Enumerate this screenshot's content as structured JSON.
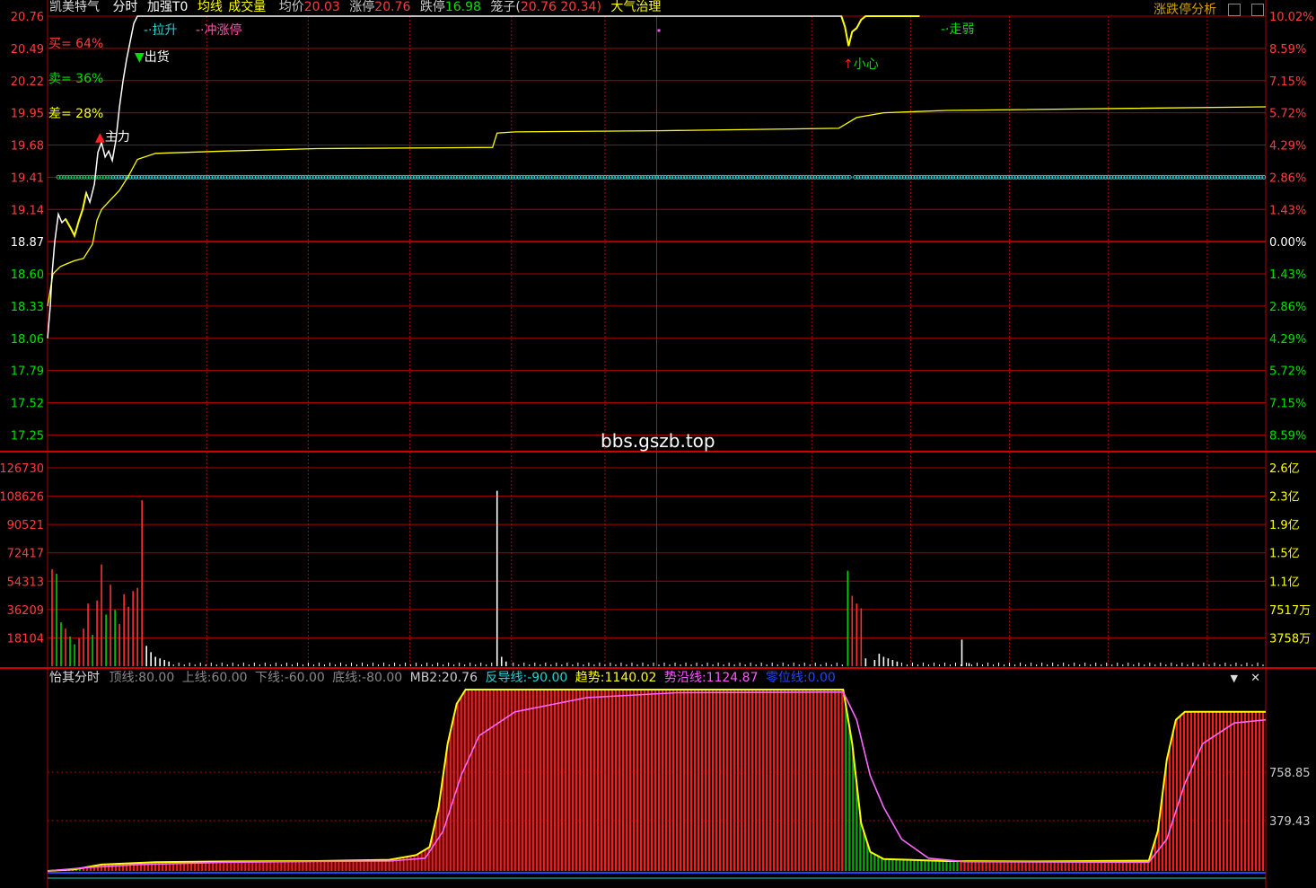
{
  "header": {
    "stock_name": "凯美特气",
    "mode": "分时",
    "strengthen": "加强T0",
    "avg_line_label": "均线",
    "volume_label": "成交量",
    "avg_price_label": "均价",
    "avg_price_value": "20.03",
    "limit_up_label": "涨停",
    "limit_up_value": "20.76",
    "limit_down_label": "跌停",
    "limit_down_value": "16.98",
    "cage_label": "笼子(",
    "cage_value": "20.76 20.34)",
    "atmos": "大气治理",
    "right_link": "涨跌停分析"
  },
  "side_labels": {
    "buy": "买= 64%",
    "sell": "卖= 36%",
    "diff": "差= 28%"
  },
  "signals": {
    "lashen": "拉升",
    "chongzhangting": "冲涨停",
    "zoruo": "走弱",
    "chuhuo": "出货",
    "zhuli": "主力",
    "xiaoxin": "小心"
  },
  "watermark": "bbs.gszb.top",
  "indicator_header": {
    "name": "怡其分时",
    "top_label": "顶线:",
    "top_value": "80.00",
    "upper_label": "上线:",
    "upper_value": "60.00",
    "lower_label": "下线:",
    "lower_value": "-60.00",
    "bottom_label": "底线:",
    "bottom_value": "-80.00",
    "mb2_label": "MB2:",
    "mb2_value": "20.76",
    "reverse_label": "反导线:",
    "reverse_value": "-90.00",
    "trend_label": "趋势:",
    "trend_value": "1140.02",
    "along_label": "势沿线:",
    "along_value": "1124.87",
    "zero_label": "零位线:",
    "zero_value": "0.00"
  },
  "colors": {
    "grid_red": "#b00000",
    "price_white": "#ffffff",
    "avg_yellow": "#ffff00",
    "label_red": "#ff3b3b",
    "label_green": "#00e000",
    "cyan": "#1fd4d4",
    "magenta": "#ff55ff"
  },
  "chart_data": [
    {
      "type": "line",
      "panel": "price",
      "y_ticks_left": [
        "20.76",
        "20.49",
        "20.22",
        "19.95",
        "19.68",
        "19.41",
        "19.14",
        "18.87",
        "18.60",
        "18.33",
        "18.06",
        "17.79",
        "17.52",
        "17.25"
      ],
      "y_ticks_right": [
        "10.02%",
        "8.59%",
        "7.15%",
        "5.72%",
        "4.29%",
        "2.86%",
        "1.43%",
        "0.00%",
        "1.43%",
        "2.86%",
        "4.29%",
        "5.72%",
        "7.15%",
        "8.59%"
      ],
      "ylim": [
        17.11,
        20.76
      ],
      "series": [
        {
          "key": "price",
          "points": [
            [
              0,
              18.06
            ],
            [
              3,
              18.33
            ],
            [
              5,
              18.6
            ],
            [
              8,
              18.87
            ],
            [
              12,
              19.1
            ],
            [
              16,
              19.03
            ],
            [
              20,
              19.06
            ],
            [
              26,
              18.98
            ],
            [
              30,
              18.92
            ],
            [
              35,
              19.05
            ],
            [
              39,
              19.14
            ],
            [
              43,
              19.28
            ],
            [
              47,
              19.2
            ],
            [
              52,
              19.35
            ],
            [
              56,
              19.62
            ],
            [
              60,
              19.7
            ],
            [
              64,
              19.58
            ],
            [
              68,
              19.63
            ],
            [
              72,
              19.55
            ],
            [
              76,
              19.72
            ],
            [
              80,
              20.0
            ],
            [
              84,
              20.22
            ],
            [
              88,
              20.4
            ],
            [
              92,
              20.55
            ],
            [
              96,
              20.7
            ],
            [
              100,
              20.76
            ],
            [
              883,
              20.76
            ],
            [
              887,
              20.67
            ],
            [
              891,
              20.51
            ],
            [
              895,
              20.63
            ],
            [
              900,
              20.66
            ],
            [
              905,
              20.73
            ],
            [
              910,
              20.76
            ],
            [
              970,
              20.76
            ]
          ]
        },
        {
          "key": "average",
          "points": [
            [
              0,
              18.33
            ],
            [
              6,
              18.6
            ],
            [
              14,
              18.66
            ],
            [
              20,
              18.68
            ],
            [
              30,
              18.71
            ],
            [
              40,
              18.73
            ],
            [
              50,
              18.85
            ],
            [
              55,
              19.05
            ],
            [
              60,
              19.14
            ],
            [
              70,
              19.22
            ],
            [
              80,
              19.3
            ],
            [
              90,
              19.42
            ],
            [
              100,
              19.56
            ],
            [
              120,
              19.61
            ],
            [
              200,
              19.63
            ],
            [
              300,
              19.65
            ],
            [
              495,
              19.66
            ],
            [
              500,
              19.78
            ],
            [
              520,
              19.79
            ],
            [
              680,
              19.8
            ],
            [
              880,
              19.82
            ],
            [
              900,
              19.91
            ],
            [
              930,
              19.95
            ],
            [
              1000,
              19.97
            ],
            [
              1355,
              20.0
            ]
          ]
        }
      ],
      "cage_line": {
        "value": 19.41,
        "x_range": [
          12,
          1355
        ],
        "gap": [
          893,
          898
        ]
      },
      "magenta_marker": {
        "x": 680,
        "y": 20.64
      }
    },
    {
      "type": "bar",
      "panel": "volume",
      "y_ticks_left": [
        "126730",
        "108626",
        "90521",
        "72417",
        "54313",
        "36209",
        "18104"
      ],
      "y_ticks_right": [
        "2.6亿",
        "2.3亿",
        "1.9亿",
        "1.5亿",
        "1.1亿",
        "7517万",
        "3758万"
      ],
      "ylim": [
        0,
        126730
      ],
      "bars": [
        {
          "x": 5,
          "v": 62000,
          "c": "r"
        },
        {
          "x": 10,
          "v": 59000,
          "c": "g"
        },
        {
          "x": 15,
          "v": 28000,
          "c": "g"
        },
        {
          "x": 20,
          "v": 24000,
          "c": "r"
        },
        {
          "x": 25,
          "v": 19000,
          "c": "g"
        },
        {
          "x": 30,
          "v": 14000,
          "c": "g"
        },
        {
          "x": 35,
          "v": 18000,
          "c": "r"
        },
        {
          "x": 40,
          "v": 24000,
          "c": "r"
        },
        {
          "x": 45,
          "v": 40000,
          "c": "r"
        },
        {
          "x": 50,
          "v": 20000,
          "c": "g"
        },
        {
          "x": 55,
          "v": 42000,
          "c": "r"
        },
        {
          "x": 60,
          "v": 65000,
          "c": "r"
        },
        {
          "x": 65,
          "v": 33000,
          "c": "g"
        },
        {
          "x": 70,
          "v": 52000,
          "c": "r"
        },
        {
          "x": 75,
          "v": 36000,
          "c": "g"
        },
        {
          "x": 80,
          "v": 27000,
          "c": "r"
        },
        {
          "x": 85,
          "v": 46000,
          "c": "r"
        },
        {
          "x": 90,
          "v": 38000,
          "c": "r"
        },
        {
          "x": 95,
          "v": 48000,
          "c": "r"
        },
        {
          "x": 100,
          "v": 50000,
          "c": "r"
        },
        {
          "x": 105,
          "v": 106000,
          "c": "r"
        },
        {
          "x": 110,
          "v": 13000,
          "c": "w"
        },
        {
          "x": 115,
          "v": 9000,
          "c": "w"
        },
        {
          "x": 120,
          "v": 6000,
          "c": "w"
        },
        {
          "x": 125,
          "v": 5000,
          "c": "w"
        },
        {
          "x": 130,
          "v": 4000,
          "c": "w"
        },
        {
          "x": 135,
          "v": 3000,
          "c": "w"
        },
        {
          "x": 500,
          "v": 112000,
          "c": "w"
        },
        {
          "x": 505,
          "v": 6000,
          "c": "w"
        },
        {
          "x": 510,
          "v": 3000,
          "c": "w"
        },
        {
          "x": 890,
          "v": 61000,
          "c": "g"
        },
        {
          "x": 895,
          "v": 45000,
          "c": "r"
        },
        {
          "x": 900,
          "v": 40000,
          "c": "r"
        },
        {
          "x": 905,
          "v": 37000,
          "c": "r"
        },
        {
          "x": 910,
          "v": 5000,
          "c": "w"
        },
        {
          "x": 920,
          "v": 4000,
          "c": "w"
        },
        {
          "x": 925,
          "v": 8000,
          "c": "w"
        },
        {
          "x": 930,
          "v": 6000,
          "c": "w"
        },
        {
          "x": 935,
          "v": 5000,
          "c": "w"
        },
        {
          "x": 940,
          "v": 4000,
          "c": "w"
        },
        {
          "x": 945,
          "v": 3000,
          "c": "w"
        },
        {
          "x": 1017,
          "v": 17000,
          "c": "w"
        },
        {
          "x": 1025,
          "v": 2000,
          "c": "w"
        }
      ]
    },
    {
      "type": "area",
      "panel": "indicator",
      "y_ticks_right": [
        "758.85",
        "379.43"
      ],
      "ylim": [
        0,
        1140.02
      ],
      "series": [
        {
          "key": "trend",
          "points": [
            [
              0,
              0
            ],
            [
              30,
              10
            ],
            [
              60,
              40
            ],
            [
              120,
              55
            ],
            [
              200,
              60
            ],
            [
              300,
              62
            ],
            [
              380,
              70
            ],
            [
              410,
              100
            ],
            [
              425,
              150
            ],
            [
              435,
              400
            ],
            [
              445,
              800
            ],
            [
              455,
              1050
            ],
            [
              465,
              1140
            ],
            [
              885,
              1140
            ],
            [
              895,
              800
            ],
            [
              905,
              300
            ],
            [
              915,
              120
            ],
            [
              930,
              75
            ],
            [
              1000,
              62
            ],
            [
              1100,
              60
            ],
            [
              1225,
              65
            ],
            [
              1235,
              250
            ],
            [
              1245,
              700
            ],
            [
              1255,
              950
            ],
            [
              1265,
              1000
            ],
            [
              1355,
              1000
            ]
          ]
        },
        {
          "key": "along",
          "points": [
            [
              0,
              0
            ],
            [
              40,
              20
            ],
            [
              100,
              40
            ],
            [
              200,
              55
            ],
            [
              300,
              60
            ],
            [
              380,
              62
            ],
            [
              420,
              80
            ],
            [
              440,
              250
            ],
            [
              460,
              600
            ],
            [
              480,
              850
            ],
            [
              520,
              1000
            ],
            [
              600,
              1090
            ],
            [
              700,
              1120
            ],
            [
              885,
              1125
            ],
            [
              900,
              950
            ],
            [
              915,
              600
            ],
            [
              930,
              400
            ],
            [
              950,
              200
            ],
            [
              980,
              80
            ],
            [
              1020,
              58
            ],
            [
              1225,
              55
            ],
            [
              1245,
              200
            ],
            [
              1265,
              550
            ],
            [
              1285,
              800
            ],
            [
              1320,
              930
            ],
            [
              1355,
              950
            ]
          ]
        }
      ]
    }
  ]
}
